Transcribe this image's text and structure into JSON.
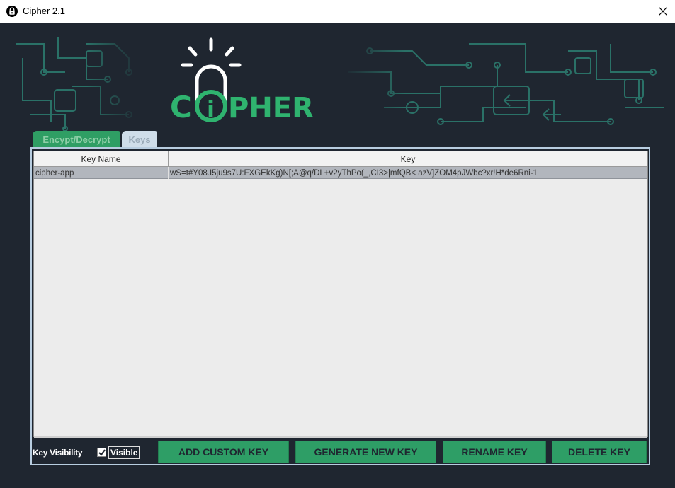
{
  "window": {
    "title": "Cipher 2.1",
    "app_icon": "lock-app-icon",
    "close_icon": "close-icon"
  },
  "banner": {
    "logo_text_prefix": "C",
    "logo_text_suffix": "PHER",
    "logo_i": "i",
    "accent_color": "#2fb36f"
  },
  "tabs": [
    {
      "label": "Encypt/Decrypt",
      "active": false
    },
    {
      "label": "Keys",
      "active": true
    }
  ],
  "table": {
    "columns": [
      "Key Name",
      "Key"
    ],
    "rows": [
      {
        "name": "cipher-app",
        "key": "wS=t#Y08.I5ju9s7U:FXGEkKg)N[;A@q/DL+v2yThPo(_,CI3>|mfQB< azV]ZOM4pJWbc?xr!H*de6Rni-1"
      }
    ]
  },
  "footer": {
    "key_visibility_label": "Key Visibility",
    "visible_label": "Visible",
    "visible_checked": true,
    "buttons": {
      "add": "ADD CUSTOM KEY",
      "generate": "GENERATE NEW KEY",
      "rename": "RENAME KEY",
      "delete": "DELETE KEY"
    }
  }
}
